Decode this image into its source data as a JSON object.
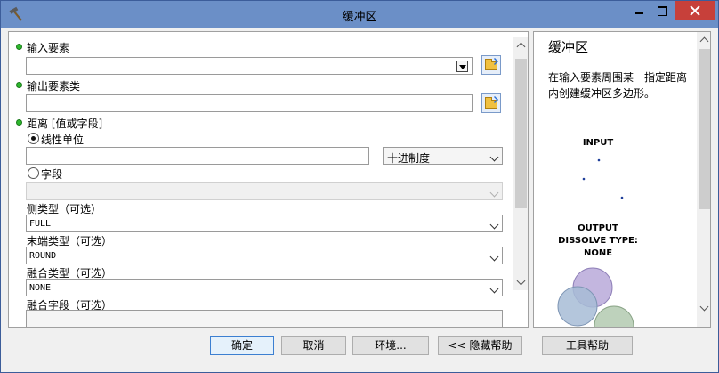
{
  "window": {
    "title": "缓冲区"
  },
  "form": {
    "input_features": {
      "label": "输入要素",
      "value": ""
    },
    "output_features": {
      "label": "输出要素类",
      "value": ""
    },
    "distance": {
      "label": "距离 [值或字段]",
      "linear_unit": {
        "label": "线性单位",
        "value": "",
        "unit": "十进制度",
        "selected": true
      },
      "field": {
        "label": "字段",
        "value": "",
        "selected": false
      }
    },
    "side_type": {
      "label": "侧类型（可选）",
      "value": "FULL"
    },
    "end_type": {
      "label": "末端类型（可选）",
      "value": "ROUND"
    },
    "dissolve_type": {
      "label": "融合类型（可选）",
      "value": "NONE"
    },
    "dissolve_field": {
      "label": "融合字段（可选）"
    }
  },
  "help": {
    "title": "缓冲区",
    "description": "在输入要素周围某一指定距离内创建缓冲区多边形。",
    "diagram": {
      "input_label": "INPUT",
      "output_label_1": "OUTPUT",
      "output_label_2": "DISSOLVE TYPE:",
      "output_label_3": "NONE"
    }
  },
  "buttons": {
    "ok": "确定",
    "cancel": "取消",
    "environments": "环境...",
    "hide_help": "<< 隐藏帮助",
    "tool_help": "工具帮助"
  },
  "colors": {
    "title_bar": "#6b8fc7",
    "close_button": "#c7403a",
    "required_dot": "#2db82d",
    "buffer_purple": "#b9a9d9",
    "buffer_blue": "#a7bcd6",
    "buffer_green": "#b3cab0"
  }
}
